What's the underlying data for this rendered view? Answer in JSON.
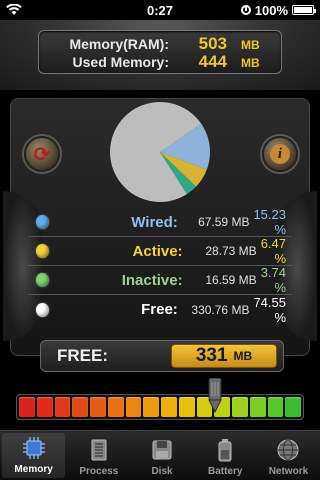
{
  "status_bar": {
    "time": "0:27",
    "battery": "100%",
    "wifi_icon": "wifi-icon",
    "lock_icon": "rotation-lock-icon",
    "battery_icon": "battery-icon"
  },
  "memory": {
    "total_label": "Memory(RAM):",
    "total_value": "503",
    "total_unit": "MB",
    "used_label": "Used Memory:",
    "used_value": "444",
    "used_unit": "MB"
  },
  "chart_data": {
    "type": "pie",
    "categories": [
      "Wired",
      "Active",
      "Inactive",
      "Free"
    ],
    "values": [
      15.23,
      6.47,
      3.74,
      74.55
    ],
    "colors": [
      "#8fb3d8",
      "#d8b233",
      "#2fa88a",
      "#bdbdbd"
    ]
  },
  "stats": [
    {
      "label": "Wired:",
      "mb": "67.59 MB",
      "pct": "15.23 %",
      "color": "#5fb0f0",
      "label_color": "#8fc0f0"
    },
    {
      "label": "Active:",
      "mb": "28.73 MB",
      "pct": "6.47 %",
      "color": "#f4d23a",
      "label_color": "#f4d23a"
    },
    {
      "label": "Inactive:",
      "mb": "16.59 MB",
      "pct": "3.74 %",
      "color": "#7ed36a",
      "label_color": "#9ad48a"
    },
    {
      "label": "Free:",
      "mb": "330.76 MB",
      "pct": "74.55 %",
      "color": "#ffffff",
      "label_color": "#ffffff"
    }
  ],
  "free": {
    "label": "FREE:",
    "value": "331",
    "unit": "MB"
  },
  "gauge": {
    "level": 0.69,
    "colors": [
      "#d8221e",
      "#e02a1c",
      "#e03a1a",
      "#e24a18",
      "#e45c16",
      "#e87014",
      "#ea8412",
      "#ec9a10",
      "#eeae10",
      "#eac010",
      "#d8cc12",
      "#c0d018",
      "#9cd020",
      "#7ccc26",
      "#58c42c",
      "#3cbc32"
    ]
  },
  "tabs": [
    {
      "label": "Memory",
      "icon": "chip-icon",
      "active": true
    },
    {
      "label": "Process",
      "icon": "document-list-icon",
      "active": false
    },
    {
      "label": "Disk",
      "icon": "disk-icon",
      "active": false
    },
    {
      "label": "Battery",
      "icon": "battery-icon",
      "active": false
    },
    {
      "label": "Network",
      "icon": "globe-icon",
      "active": false
    }
  ],
  "buttons": {
    "refresh_icon": "refresh-icon",
    "info_icon": "info-icon",
    "info_glyph": "i",
    "refresh_glyph": "⟳"
  }
}
